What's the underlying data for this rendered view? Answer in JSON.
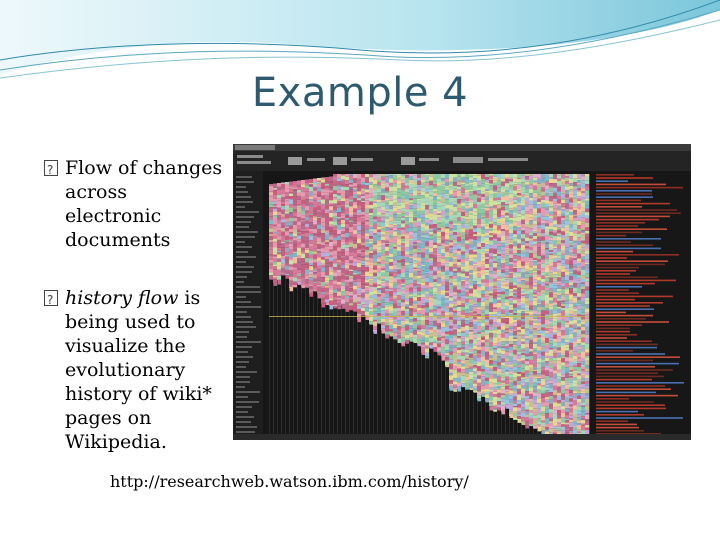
{
  "slide": {
    "title": "Example 4",
    "bullets": [
      {
        "text": "Flow of changes across electronic documents"
      },
      {
        "italic": "history flow",
        "rest": " is being used to visualize the evolutionary history of wiki* pages on Wikipedia."
      }
    ],
    "url": "http://researchweb.watson.ibm.com/history/"
  },
  "colors": {
    "title": "#2d5a6f",
    "wave": "#6fc3d8"
  }
}
